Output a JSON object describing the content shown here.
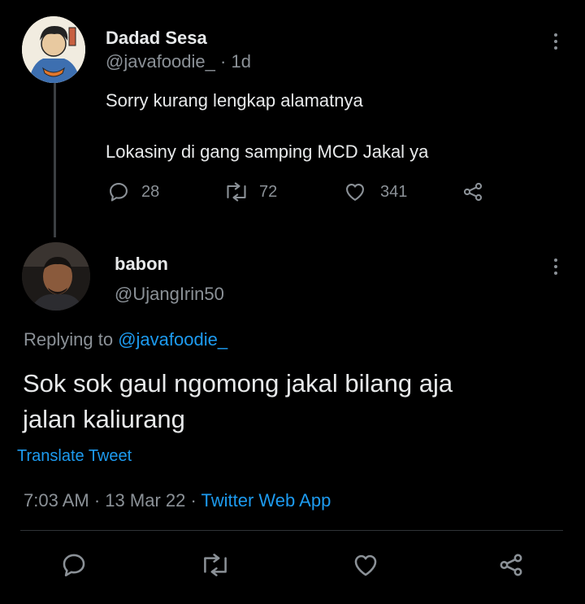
{
  "parent_tweet": {
    "display_name": "Dadad Sesa",
    "handle": "@javafoodie_",
    "separator": "·",
    "age": "1d",
    "text_line1": "Sorry kurang lengkap alamatnya",
    "text_line2": "Lokasiny di gang samping MCD Jakal ya",
    "reply_count": "28",
    "retweet_count": "72",
    "like_count": "341"
  },
  "main_tweet": {
    "display_name": "babon",
    "handle": "@UjangIrin50",
    "replying_prefix": "Replying to",
    "replying_handle": "@javafoodie_",
    "text_line1": "Sok sok gaul ngomong jakal bilang aja",
    "text_line2": "jalan kaliurang",
    "translate_label": "Translate Tweet",
    "time": "7:03 AM",
    "sep1": "·",
    "date": "13 Mar 22",
    "sep2": "·",
    "source": "Twitter Web App"
  },
  "icons": {
    "reply": "reply-icon",
    "retweet": "retweet-icon",
    "like": "heart-icon",
    "share": "share-icon",
    "more": "more-icon"
  },
  "colors": {
    "background": "#000000",
    "text": "#e7e9ea",
    "muted": "#8b9197",
    "link": "#1d9bf0",
    "divider": "#2f3336"
  }
}
